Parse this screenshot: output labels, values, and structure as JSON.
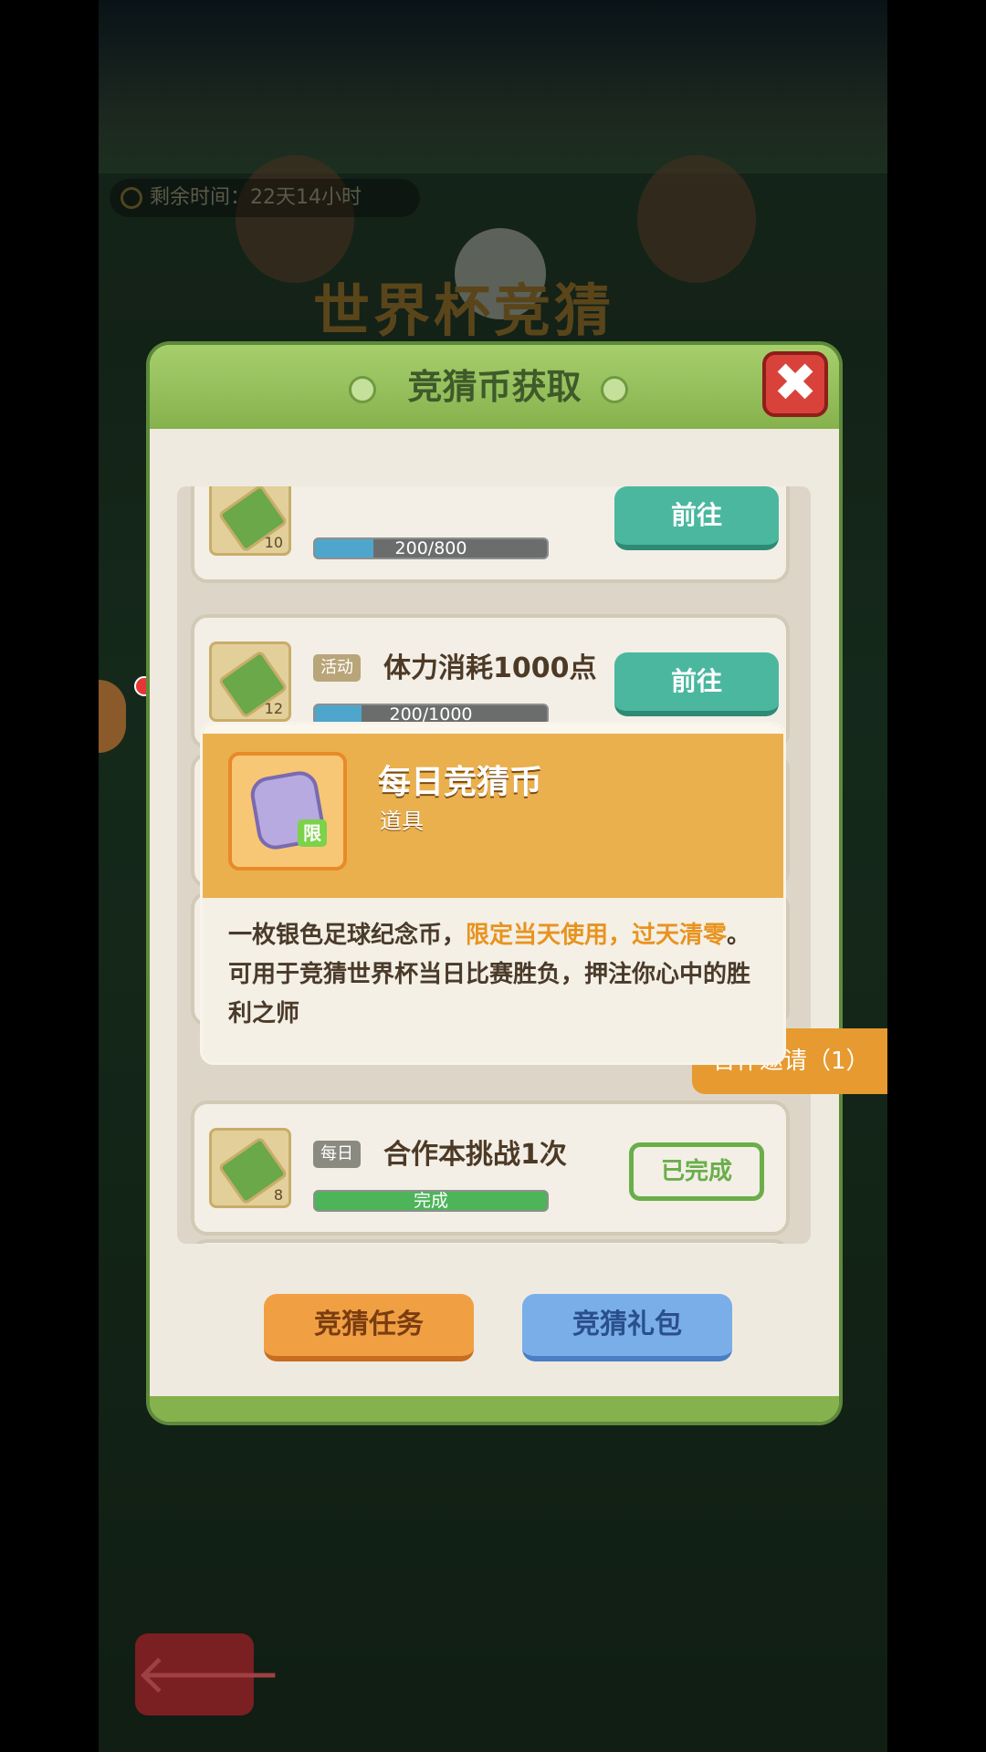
{
  "background": {
    "timer_label": "剩余时间：",
    "timer_value": "22天14小时",
    "event_title": "世界杯竞猜"
  },
  "dialog": {
    "title": "竞猜币获取",
    "close_label": "✖",
    "tasks": [
      {
        "icon_count": "10",
        "progress_text": "200/800",
        "progress": 0.25,
        "action": "前往",
        "status": "go"
      },
      {
        "tag": "活动",
        "name": "体力消耗1000点",
        "icon_count": "12",
        "progress_text": "200/1000",
        "progress": 0.2,
        "action": "前往",
        "status": "go"
      },
      {
        "tag": "每日",
        "name": "合作本挑战1次",
        "icon_count": "8",
        "progress_text": "完成",
        "progress": 1.0,
        "action": "已完成",
        "status": "done"
      }
    ],
    "buttons": {
      "task": "竞猜任务",
      "gift": "竞猜礼包"
    }
  },
  "invite_tab": "合作邀请（1）",
  "tooltip": {
    "name": "每日竞猜币",
    "type": "道具",
    "limit_badge": "限",
    "desc_part1": "一枚银色足球纪念币，",
    "desc_highlight": "限定当天使用，过天清零",
    "desc_part2": "。可用于竞猜世界杯当日比赛胜负，押注你心中的胜利之师"
  },
  "back_button": "🡐",
  "colors": {
    "accent_green": "#86b24e",
    "go_button": "#4bb79f",
    "highlight_orange": "#e8931f",
    "tooltip_header": "#eab04e"
  }
}
